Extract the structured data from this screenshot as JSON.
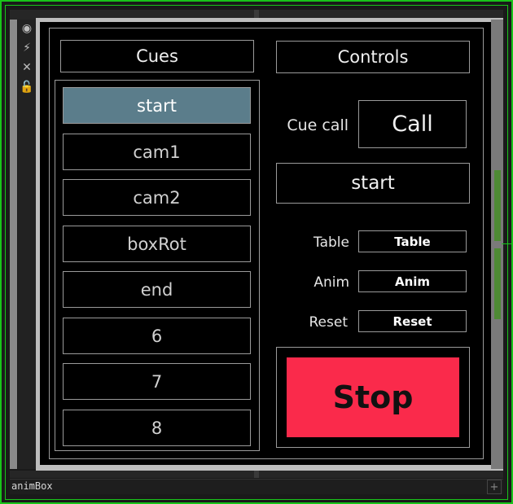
{
  "cues": {
    "header": "Cues",
    "items": [
      "start",
      "cam1",
      "cam2",
      "boxRot",
      "end",
      "6",
      "7",
      "8"
    ],
    "active_index": 0
  },
  "controls": {
    "header": "Controls",
    "cue_call_label": "Cue call",
    "call_button": "Call",
    "current_cue": "start",
    "table_label": "Table",
    "table_button": "Table",
    "anim_label": "Anim",
    "anim_button": "Anim",
    "reset_label": "Reset",
    "reset_button": "Reset",
    "stop_button": "Stop"
  },
  "footer": {
    "name": "animBox",
    "add_symbol": "+"
  },
  "colors": {
    "border_green": "#19c41a",
    "active_cue": "#5b7d8b",
    "stop": "#fa2a4b"
  }
}
